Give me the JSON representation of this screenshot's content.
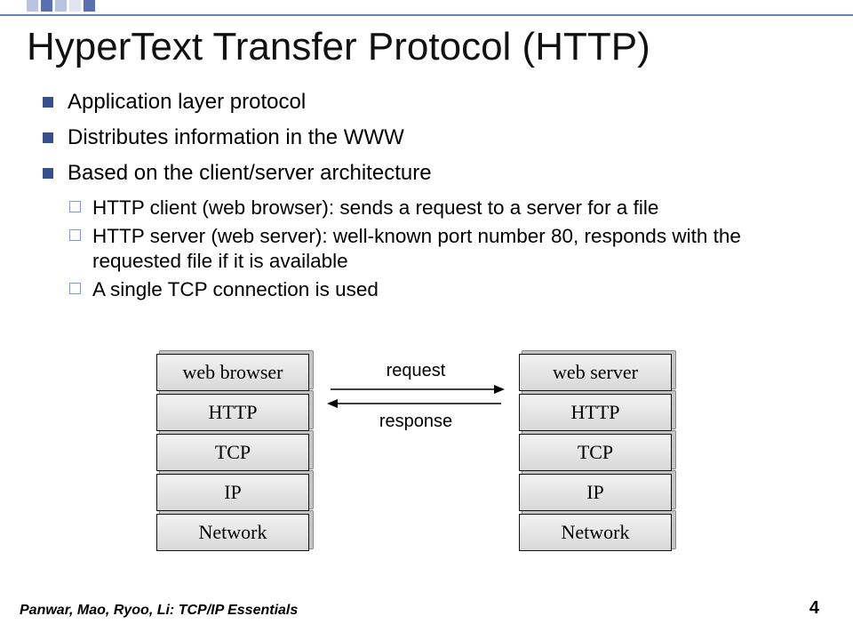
{
  "title": "HyperText Transfer Protocol (HTTP)",
  "bullets": {
    "b1": "Application layer protocol",
    "b2": "Distributes information in the WWW",
    "b3": "Based on the client/server architecture",
    "sub1": "HTTP client (web browser): sends a request to a server for a file",
    "sub2": "HTTP server (web server): well-known port number 80, responds with the requested file if it is available",
    "sub3": "A single TCP connection is used"
  },
  "diagram": {
    "left_stack": [
      "web browser",
      "HTTP",
      "TCP",
      "IP",
      "Network"
    ],
    "right_stack": [
      "web server",
      "HTTP",
      "TCP",
      "IP",
      "Network"
    ],
    "request_label": "request",
    "response_label": "response"
  },
  "footer": {
    "authors": "Panwar, Mao, Ryoo, Li: TCP/IP Essentials",
    "page": "4"
  }
}
